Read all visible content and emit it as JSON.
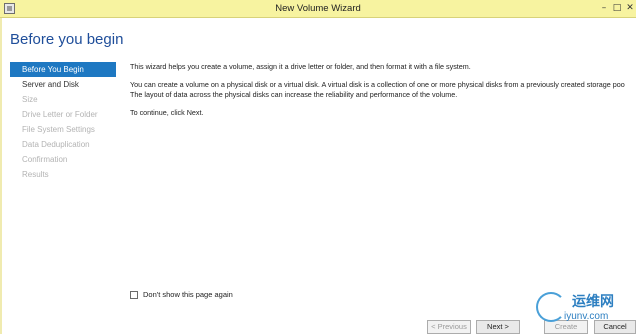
{
  "window": {
    "title": "New Volume Wizard",
    "minimize_glyph": "–",
    "maximize_glyph": "□",
    "close_glyph": "✕"
  },
  "page": {
    "title": "Before you begin"
  },
  "nav": {
    "items": [
      {
        "label": "Before You Begin",
        "state": "active"
      },
      {
        "label": "Server and Disk",
        "state": "enabled"
      },
      {
        "label": "Size",
        "state": "disabled"
      },
      {
        "label": "Drive Letter or Folder",
        "state": "disabled"
      },
      {
        "label": "File System Settings",
        "state": "disabled"
      },
      {
        "label": "Data Deduplication",
        "state": "disabled"
      },
      {
        "label": "Confirmation",
        "state": "disabled"
      },
      {
        "label": "Results",
        "state": "disabled"
      }
    ]
  },
  "content": {
    "paragraph1": "This wizard helps you create a volume, assign it a drive letter or folder, and then format it with a file system.",
    "paragraph2_line1": "You can create a volume on a physical disk or a virtual disk. A virtual disk is a collection of one or more physical disks from a previously created storage poo",
    "paragraph2_line2": "The layout of data across the physical disks can increase the reliability and performance of the volume.",
    "paragraph3": "To continue, click Next."
  },
  "footer": {
    "checkbox_label": "Don't show this page again",
    "checkbox_checked": false,
    "prev_label": "< Previous",
    "next_label": "Next >",
    "create_label": "Create",
    "cancel_label": "Cancel"
  },
  "watermark": {
    "title": "运维网",
    "url": "iyunv.com"
  },
  "colors": {
    "titlebar": "#f7f3a0",
    "accent": "#1e78c2",
    "page_title": "#1f4e9a"
  }
}
